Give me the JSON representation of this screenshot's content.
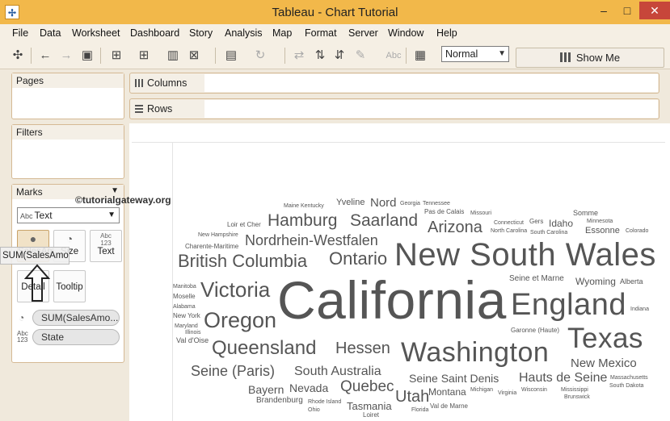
{
  "window": {
    "title": "Tableau - Chart Tutorial"
  },
  "menu": [
    "File",
    "Data",
    "Worksheet",
    "Dashboard",
    "Story",
    "Analysis",
    "Map",
    "Format",
    "Server",
    "Window",
    "Help"
  ],
  "toolbar": {
    "fit_value": "Normal",
    "show_me_label": "Show Me",
    "abc_label": "Abc"
  },
  "panels": {
    "pages": "Pages",
    "filters": "Filters",
    "marks": "Marks"
  },
  "marks": {
    "type": "Text",
    "type_icon": "Abc",
    "buttons": {
      "color": "SalesAmo",
      "size": "Size",
      "text": "Text",
      "detail": "Detail",
      "tooltip": "Tooltip"
    },
    "text_icon_line1": "Abc",
    "text_icon_line2": "123",
    "drag_tooltip": "SUM(SalesAmo",
    "pills": {
      "measure": "SUM(SalesAmo...",
      "dimension": "State"
    }
  },
  "shelves": {
    "columns": "Columns",
    "rows": "Rows"
  },
  "watermark": "©tutorialgateway.org",
  "chart_data": {
    "type": "word-cloud",
    "measure": "SUM(SalesAmount)",
    "dimension": "State",
    "words": [
      {
        "text": "Maine"
      },
      {
        "text": "Kentucky"
      },
      {
        "text": "Yveline"
      },
      {
        "text": "Nord"
      },
      {
        "text": "Georgia"
      },
      {
        "text": "Tennessee"
      },
      {
        "text": "Pas de Calais"
      },
      {
        "text": "Missouri"
      },
      {
        "text": "Somme"
      },
      {
        "text": "Loir et Cher"
      },
      {
        "text": "Hamburg"
      },
      {
        "text": "Saarland"
      },
      {
        "text": "Arizona"
      },
      {
        "text": "Connecticut"
      },
      {
        "text": "Gers"
      },
      {
        "text": "Idaho"
      },
      {
        "text": "Minnesota"
      },
      {
        "text": "New Hampshire"
      },
      {
        "text": "North Carolina"
      },
      {
        "text": "South Carolina"
      },
      {
        "text": "Essonne"
      },
      {
        "text": "Colorado"
      },
      {
        "text": "Nordrhein-Westfalen"
      },
      {
        "text": "Charente-Maritime"
      },
      {
        "text": "British Columbia"
      },
      {
        "text": "Ontario"
      },
      {
        "text": "New South Wales"
      },
      {
        "text": "Seine et Marne"
      },
      {
        "text": "Wyoming"
      },
      {
        "text": "Alberta"
      },
      {
        "text": "Manitoba"
      },
      {
        "text": "Victoria"
      },
      {
        "text": "California"
      },
      {
        "text": "England"
      },
      {
        "text": "Moselle"
      },
      {
        "text": "Alabama"
      },
      {
        "text": "Indiana"
      },
      {
        "text": "New York"
      },
      {
        "text": "Oregon"
      },
      {
        "text": "Maryland"
      },
      {
        "text": "Illinois"
      },
      {
        "text": "Garonne (Haute)"
      },
      {
        "text": "Texas"
      },
      {
        "text": "Val d'Oise"
      },
      {
        "text": "Queensland"
      },
      {
        "text": "Hessen"
      },
      {
        "text": "Washington"
      },
      {
        "text": "New Mexico"
      },
      {
        "text": "Seine (Paris)"
      },
      {
        "text": "South Australia"
      },
      {
        "text": "Seine Saint Denis"
      },
      {
        "text": "Hauts de Seine"
      },
      {
        "text": "Massachusetts"
      },
      {
        "text": "South Dakota"
      },
      {
        "text": "Bayern"
      },
      {
        "text": "Nevada"
      },
      {
        "text": "Quebec"
      },
      {
        "text": "Montana"
      },
      {
        "text": "Michigan"
      },
      {
        "text": "Virginia"
      },
      {
        "text": "Wisconsin"
      },
      {
        "text": "Mississippi"
      },
      {
        "text": "Brunswick"
      },
      {
        "text": "Brandenburg"
      },
      {
        "text": "Rhode Island"
      },
      {
        "text": "Utah"
      },
      {
        "text": "Tasmania"
      },
      {
        "text": "Ohio"
      },
      {
        "text": "Florida"
      },
      {
        "text": "Val de Marne"
      },
      {
        "text": "Loiret"
      }
    ]
  }
}
